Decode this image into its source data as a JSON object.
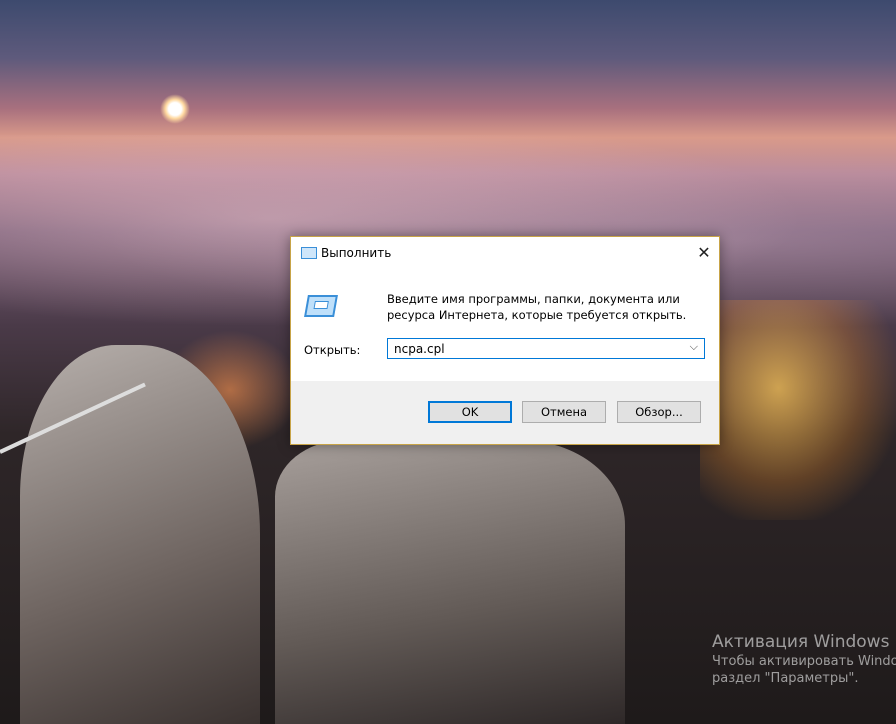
{
  "dialog": {
    "title": "Выполнить",
    "description": "Введите имя программы, папки, документа или ресурса Интернета, которые требуется открыть.",
    "open_label": "Открыть:",
    "open_value": "ncpa.cpl",
    "ok_label": "OK",
    "cancel_label": "Отмена",
    "browse_label": "Обзор...",
    "close_glyph": "✕",
    "chevron_glyph": "⌵"
  },
  "watermark": {
    "title": "Активация Windows",
    "line1": "Чтобы активировать Windo",
    "line2": "раздел \"Параметры\"."
  },
  "colors": {
    "accent": "#0078d7",
    "dialog_border": "#c8a448"
  }
}
